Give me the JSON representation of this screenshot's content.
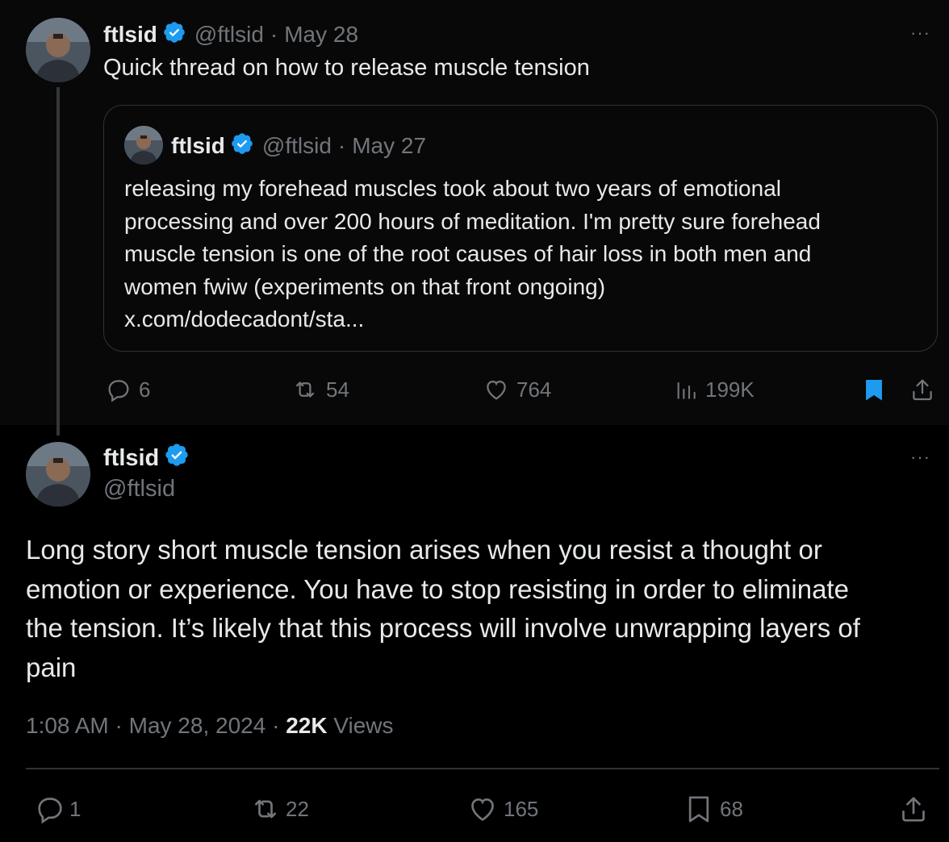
{
  "colors": {
    "background": "#000000",
    "top_post_bg": "#080808",
    "text": "#e7e9ea",
    "muted": "#71767b",
    "verified": "#1d9bf0",
    "bookmarked": "#1d9bf0"
  },
  "post1": {
    "author_name": "ftlsid",
    "handle": "@ftlsid",
    "separator": "·",
    "date": "May 28",
    "text": "Quick thread on how to release muscle tension",
    "more": "···",
    "quoted": {
      "author_name": "ftlsid",
      "handle": "@ftlsid",
      "separator": "·",
      "date": "May 27",
      "lines": [
        "releasing my forehead muscles took about two years of emotional",
        "processing and over 200 hours of meditation. I'm pretty sure forehead",
        "muscle tension is one of the root causes of hair loss in both men and",
        "women fwiw (experiments on that front ongoing)",
        "x.com/dodecadont/sta..."
      ]
    },
    "actions": {
      "replies": "6",
      "reposts": "54",
      "likes": "764",
      "views": "199K",
      "bookmarked": true
    }
  },
  "post2": {
    "author_name": "ftlsid",
    "handle": "@ftlsid",
    "more": "···",
    "lines": [
      "Long story short muscle tension arises when you resist a thought or",
      "emotion or experience. You have to stop resisting in order to eliminate",
      "the tension. It’s likely that this process will involve unwrapping layers of",
      "pain"
    ],
    "time": "1:08 AM",
    "separator": "·",
    "date": "May 28, 2024",
    "separator2": "·",
    "views_count": "22K",
    "views_label": "Views",
    "actions": {
      "replies": "1",
      "reposts": "22",
      "likes": "165",
      "bookmarks": "68"
    }
  }
}
